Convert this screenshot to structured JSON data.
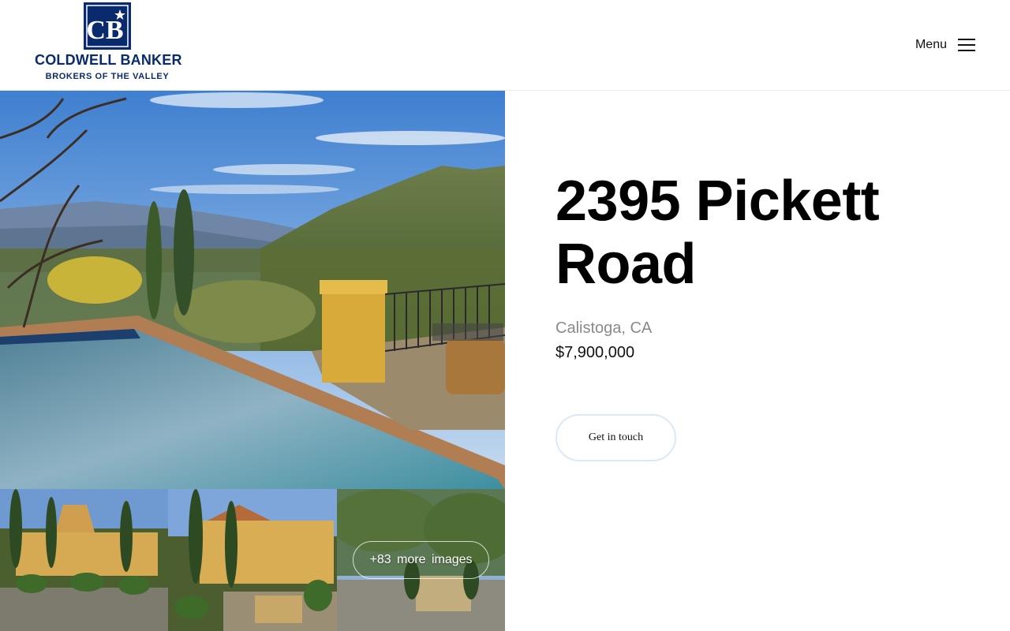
{
  "brand": {
    "line1": "COLDWELL BANKER",
    "line2": "BROKERS OF THE VALLEY",
    "mark": "CB",
    "color": "#0a2a6e"
  },
  "header": {
    "menu_label": "Menu",
    "menu_icon": "hamburger-icon"
  },
  "listing": {
    "address": "2395 Pickett Road",
    "location": "Calistoga, CA",
    "price": "$7,900,000",
    "cta_label": "Get in touch"
  },
  "gallery": {
    "more_images_label": "+83 more images"
  }
}
